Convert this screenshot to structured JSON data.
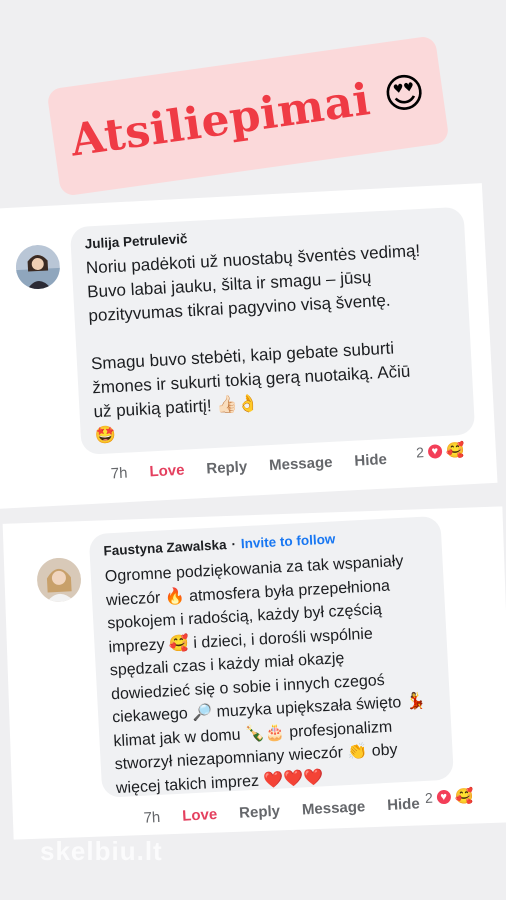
{
  "title": {
    "text": "Atsiliepimai",
    "emoji": "😍"
  },
  "reviews": [
    {
      "author": "Julija Petrulevič",
      "body": "Noriu padėkoti už nuostabų šventės vedimą! Buvo labai jauku, šilta ir smagu – jūsų pozityvumas tikrai pagyvino visą šventę.\n\nSmagu buvo stebėti, kaip gebate suburti žmones ir sukurti tokią gerą nuotaiką. Ačiū už puikią patirtį! 👍🏻👌\n🤩",
      "time": "7h",
      "love": "Love",
      "reply": "Reply",
      "message": "Message",
      "hide": "Hide",
      "reaction_count": "2"
    },
    {
      "author": "Faustyna Zawalska",
      "separator": "·",
      "follow": "Invite to follow",
      "body": "Ogromne podziękowania za tak wspaniały wieczór 🔥 atmosfera była przepełniona spokojem i radością, każdy był częścią imprezy 🥰 i dzieci, i dorośli wspólnie spędzali czas i każdy miał okazję dowiedzieć się o sobie i innych czegoś ciekawego 🔎 muzyka upiększała święto 💃 klimat jak w domu 🍾🎂 profesjonalizm stworzył niezapomniany wieczór 👏 oby więcej takich imprez ❤️❤️❤️",
      "time": "7h",
      "love": "Love",
      "reply": "Reply",
      "message": "Message",
      "hide": "Hide",
      "reaction_count": "2"
    }
  ],
  "watermark": "skelbiu.lt"
}
